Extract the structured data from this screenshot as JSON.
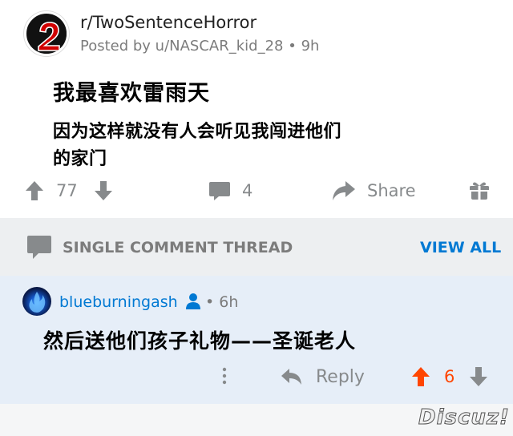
{
  "post": {
    "subreddit": "r/TwoSentenceHorror",
    "meta": "Posted by u/NASCAR_kid_28 • 9h",
    "title": "我最喜欢雷雨天",
    "body_line1": "因为这样就没有人会听见我闯进他们",
    "body_line2": "的家门",
    "score": "77",
    "comments": "4",
    "share_label": "Share",
    "icons": [
      "upvote-icon",
      "downvote-icon",
      "comment-icon",
      "share-icon",
      "gift-icon"
    ]
  },
  "thread": {
    "label": "SINGLE COMMENT THREAD",
    "view_all": "VIEW ALL"
  },
  "comment": {
    "user": "blueburningash",
    "time": "• 6h",
    "text": "然后送他们孩子礼物——圣诞老人",
    "reply_label": "Reply",
    "score": "6"
  },
  "watermark": "Discuz!",
  "colors": {
    "accent": "#0079d3",
    "upvoted": "#ff4500",
    "icon_gray": "#878a8c",
    "comment_bg": "#e6eef8",
    "banner_bg": "#edeff1"
  }
}
